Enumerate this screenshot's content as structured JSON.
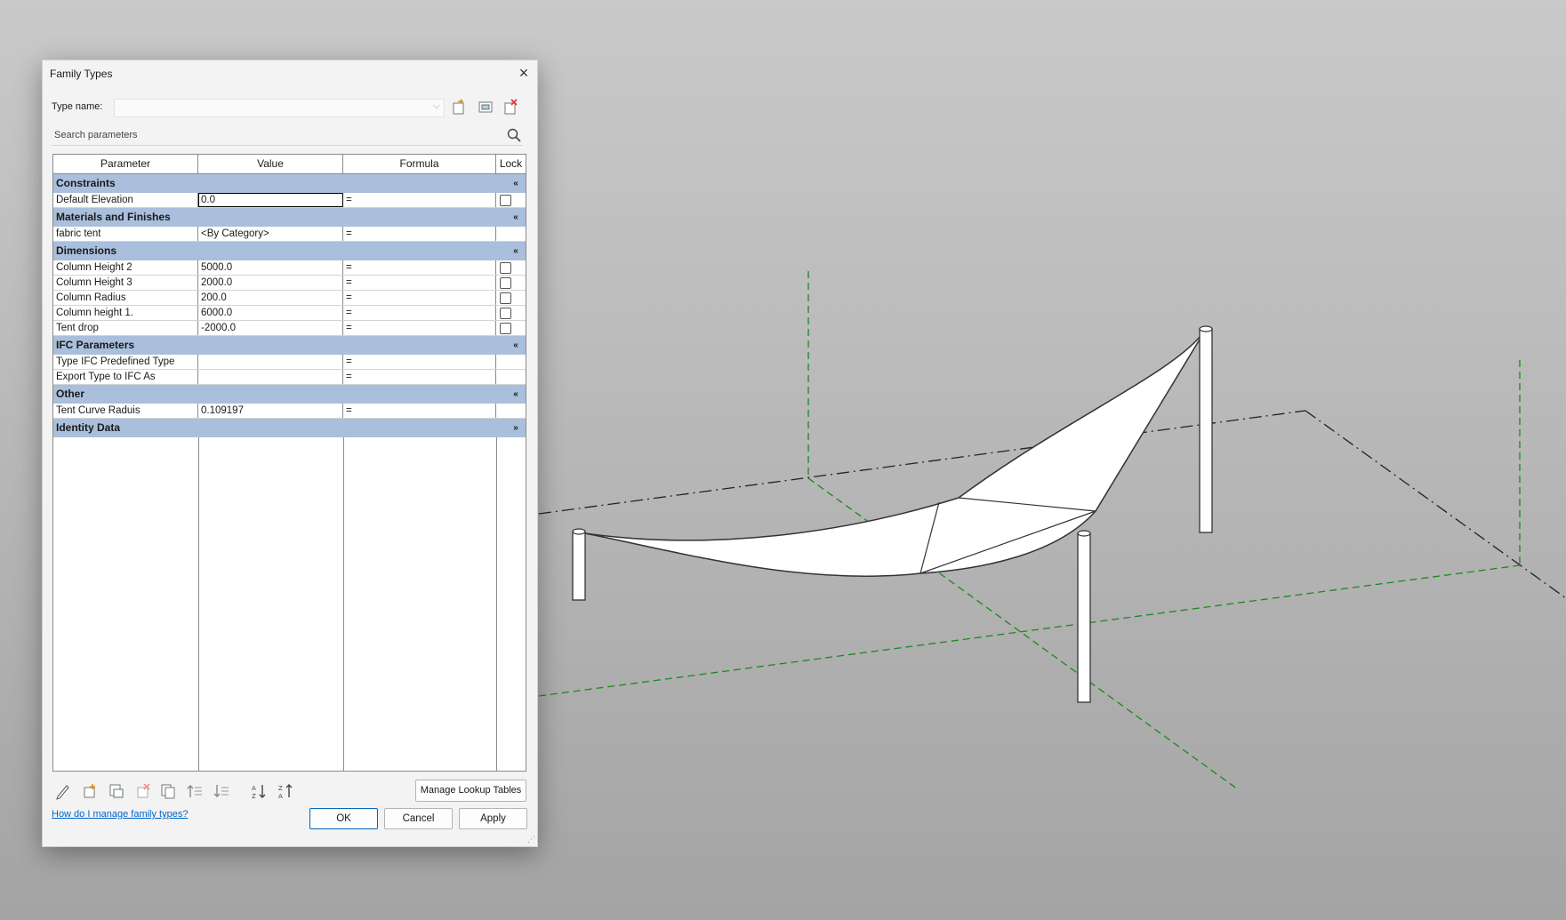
{
  "dialog": {
    "title": "Family Types",
    "type_name_label": "Type name:",
    "type_name_value": "",
    "search_placeholder": "Search parameters",
    "columns": [
      "Parameter",
      "Value",
      "Formula",
      "Lock"
    ],
    "groups": [
      {
        "name": "Constraints",
        "toggle": "«",
        "params": [
          {
            "name": "Default Elevation",
            "value": "0.0",
            "formula": "=",
            "lock": false
          }
        ]
      },
      {
        "name": "Materials and Finishes",
        "toggle": "«",
        "params": [
          {
            "name": "fabric tent",
            "value": "<By Category>",
            "formula": "=",
            "lock": null
          }
        ]
      },
      {
        "name": "Dimensions",
        "toggle": "«",
        "params": [
          {
            "name": "Column Height 2",
            "value": "5000.0",
            "formula": "=",
            "lock": false
          },
          {
            "name": "Column Height 3",
            "value": "2000.0",
            "formula": "=",
            "lock": false
          },
          {
            "name": "Column Radius",
            "value": "200.0",
            "formula": "=",
            "lock": false
          },
          {
            "name": "Column height 1.",
            "value": "6000.0",
            "formula": "=",
            "lock": false
          },
          {
            "name": "Tent drop",
            "value": "-2000.0",
            "formula": "=",
            "lock": false
          }
        ]
      },
      {
        "name": "IFC Parameters",
        "toggle": "«",
        "params": [
          {
            "name": "Type IFC Predefined Type",
            "value": "",
            "formula": "=",
            "lock": null
          },
          {
            "name": "Export Type to IFC As",
            "value": "",
            "formula": "=",
            "lock": null
          }
        ]
      },
      {
        "name": "Other",
        "toggle": "«",
        "params": [
          {
            "name": "Tent Curve Raduis",
            "value": "0.109197",
            "formula": "=",
            "lock": null
          }
        ]
      },
      {
        "name": "Identity Data",
        "toggle": "»",
        "params": []
      }
    ],
    "manage_lookup_label": "Manage Lookup Tables",
    "help_link": "How do I manage family types?",
    "ok_label": "OK",
    "cancel_label": "Cancel",
    "apply_label": "Apply"
  },
  "toolbar_icons": [
    "new-type-icon",
    "rename-type-icon",
    "delete-type-icon"
  ],
  "bottom_icons": [
    "edit-parameter-icon",
    "new-parameter-icon",
    "shared-parameter-icon",
    "delete-parameter-icon",
    "copy-parameter-icon",
    "move-up-icon",
    "move-down-icon",
    "sort-ascending-icon",
    "sort-descending-icon"
  ],
  "colors": {
    "group_header": "#a9bfdc",
    "link": "#0066cc",
    "grid_lines": "#1a8a1a"
  }
}
